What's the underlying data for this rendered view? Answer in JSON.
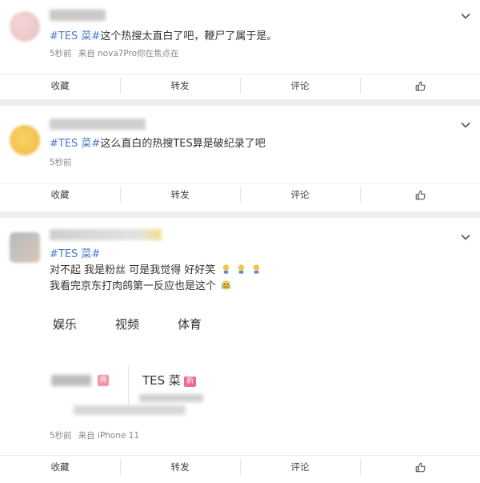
{
  "posts": [
    {
      "hashtag": "#TES 菜#",
      "text": "这个热搜太直白了吧，鞭尸了属于是。",
      "time": "5秒前",
      "source": "来自 nova7Pro你在焦点在"
    },
    {
      "hashtag": "#TES 菜#",
      "text": "这么直白的热搜TES算是破纪录了吧",
      "time": "5秒前",
      "source": ""
    },
    {
      "hashtag": "#TES 菜#",
      "line1": "对不起 我是粉丝 可是我觉得 好好笑",
      "line2": "我看完京东打肉鸽第一反应也是这个",
      "embed_tabs": [
        "娱乐",
        "视频",
        "体育"
      ],
      "embed_topic": "TES 菜",
      "embed_badge": "新",
      "embed_badge_left": "商",
      "time": "5秒前",
      "source": "来自 iPhone 11"
    }
  ],
  "actions": {
    "collect": "收藏",
    "repost": "转发",
    "comment": "评论"
  },
  "icons": {
    "chevron": "chevron-down-icon",
    "like": "thumbs-up-icon",
    "emoji": "crying-face-emoji"
  },
  "colors": {
    "hashtag": "#4a7bc8",
    "badge": "#f06a8c",
    "page_bg": "#eceff2"
  }
}
